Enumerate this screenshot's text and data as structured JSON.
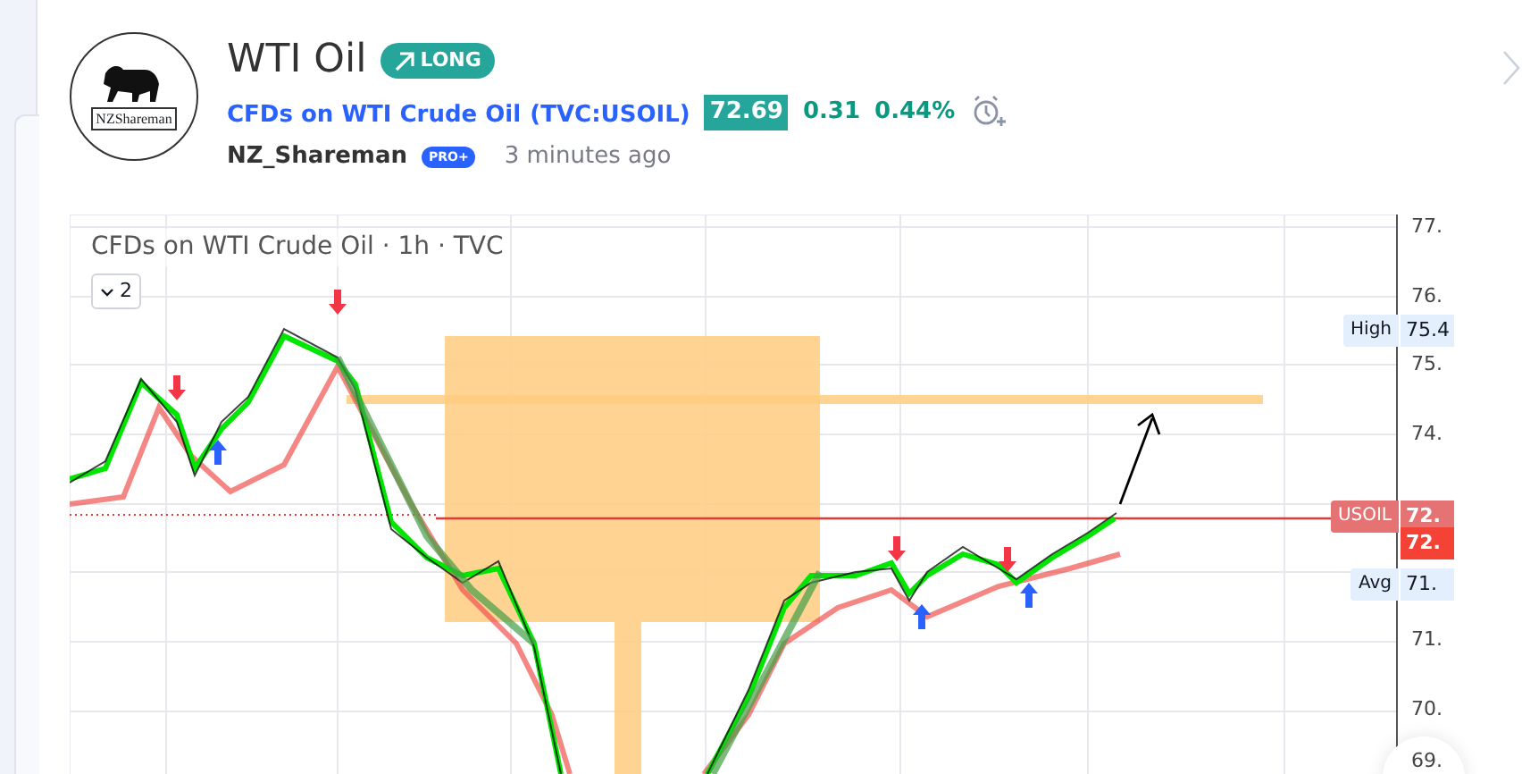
{
  "idea": {
    "logo_text": "NZShareman",
    "title": "WTI Oil",
    "direction": {
      "label": "LONG",
      "kind": "long"
    },
    "symbol_name": "CFDs on WTI Crude Oil",
    "symbol_code": "(TVC:USOIL)",
    "price": "72.69",
    "change": "0.31",
    "change_percent": "0.44%",
    "author": "NZ_Shareman",
    "author_badge": "PRO+",
    "time": "3 minutes ago"
  },
  "chart": {
    "legend": "CFDs on WTI Crude Oil · 1h · TVC",
    "collapse_count": "2",
    "price_scale": [
      "77.",
      "76.",
      "75.",
      "74.",
      "71.",
      "70.",
      "69."
    ],
    "tags": [
      {
        "kind": "high",
        "label": "High",
        "value": "75.4"
      },
      {
        "kind": "last",
        "label": "USOIL",
        "value": "72."
      },
      {
        "kind": "current",
        "value": "72."
      },
      {
        "kind": "avg",
        "label": "Avg",
        "value": "71."
      }
    ]
  }
}
